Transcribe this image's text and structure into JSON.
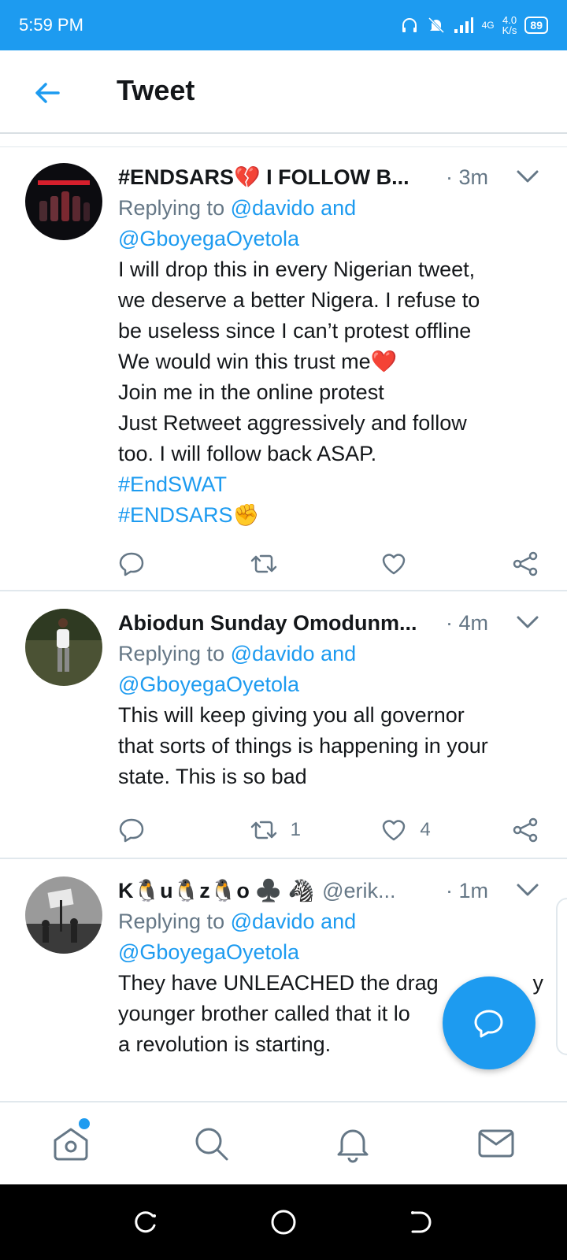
{
  "status_bar": {
    "time": "5:59 PM",
    "network": "4G",
    "speed_value": "4.0",
    "speed_unit": "K/s",
    "battery": "89"
  },
  "header": {
    "title": "Tweet"
  },
  "tweets": [
    {
      "author": "#ENDSARS💔 I FOLLOW B...",
      "handle": "",
      "time": "· 3m",
      "reply_prefix": "Replying to ",
      "reply_mentions": "@davido and",
      "reply_mentions_2": "@GboyegaOyetola",
      "lines": [
        "I will drop this in every Nigerian tweet,",
        "we deserve a better Nigera. I refuse to",
        "be useless since I can’t protest offline",
        "We would win this trust me❤️",
        "Join me in the online protest",
        "Just Retweet aggressively and follow",
        "too. I will follow back ASAP."
      ],
      "hashtags": [
        "#EndSWAT",
        "#ENDSARS"
      ],
      "hashtag_emoji": "✊",
      "retweets": "",
      "likes": ""
    },
    {
      "author": "Abiodun Sunday Omodunm...",
      "handle": "",
      "time": "· 4m",
      "reply_prefix": "Replying to ",
      "reply_mentions": "@davido and",
      "reply_mentions_2": "@GboyegaOyetola",
      "lines": [
        "This will keep giving you all governor",
        "that sorts of things is happening in your",
        "state. This is so bad"
      ],
      "retweets": "1",
      "likes": "4"
    },
    {
      "author": "K🐧u🐧z🐧o ♣️ 🦓",
      "handle": "@erik...",
      "time": "· 1m",
      "reply_prefix": "Replying to ",
      "reply_mentions": "@davido and",
      "reply_mentions_2": "@GboyegaOyetola",
      "lines": [
        "They have UNLEACHED the drag",
        "younger brother called that it lo",
        "a revolution is starting."
      ],
      "line_tail": "y"
    }
  ],
  "icons": {
    "back": "arrow-left-icon",
    "reply": "speech-bubble-icon",
    "retweet": "retweet-icon",
    "like": "heart-icon",
    "share": "share-icon",
    "compose": "compose-reply-icon",
    "nav": [
      "home-icon",
      "search-icon",
      "bell-icon",
      "mail-icon"
    ]
  },
  "colors": {
    "accent": "#1d9bf0",
    "text": "#14171a",
    "muted": "#657786"
  }
}
